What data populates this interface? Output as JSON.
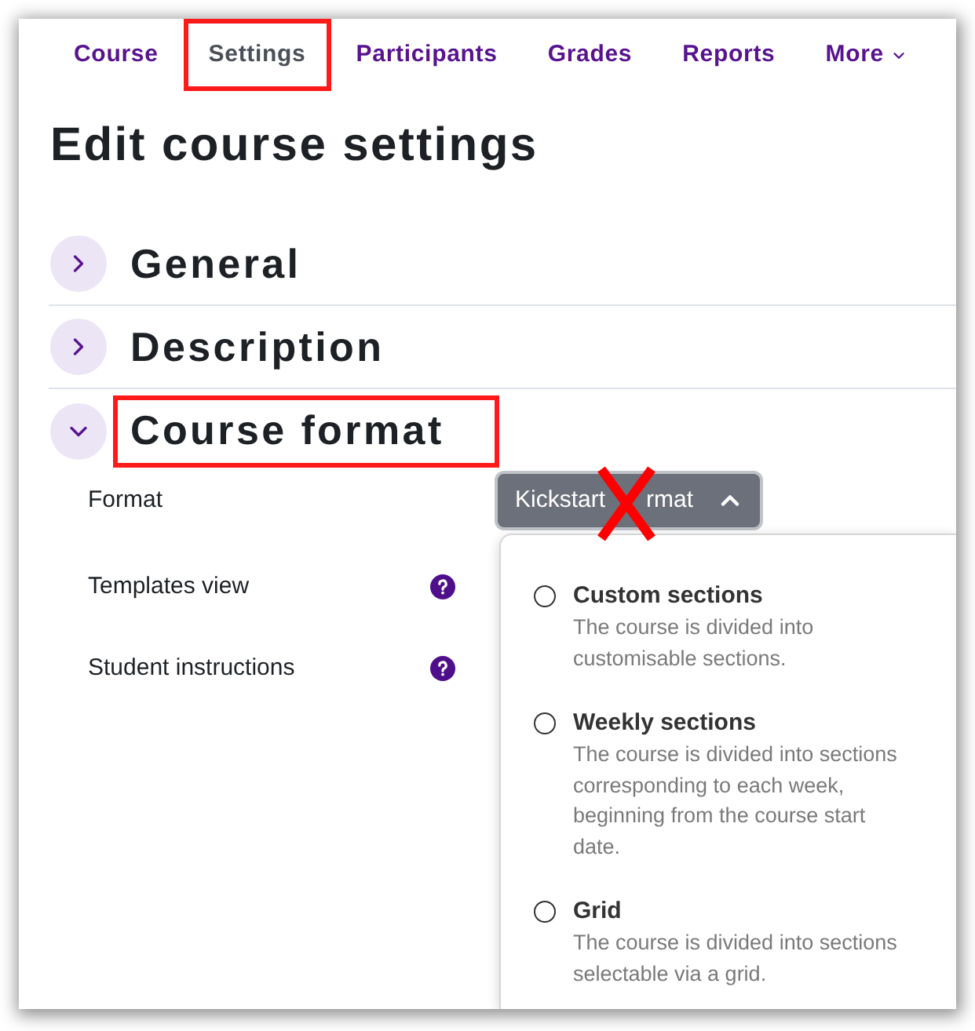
{
  "nav": {
    "items": [
      {
        "label": "Course",
        "selected": false,
        "highlighted": false,
        "kind": "link"
      },
      {
        "label": "Settings",
        "selected": true,
        "highlighted": true,
        "kind": "link"
      },
      {
        "label": "Participants",
        "selected": false,
        "highlighted": false,
        "kind": "link"
      },
      {
        "label": "Grades",
        "selected": false,
        "highlighted": false,
        "kind": "link"
      },
      {
        "label": "Reports",
        "selected": false,
        "highlighted": false,
        "kind": "link"
      },
      {
        "label": "More",
        "selected": false,
        "highlighted": false,
        "kind": "menu"
      }
    ]
  },
  "page_title": "Edit course settings",
  "sections": [
    {
      "title": "General",
      "expanded": false,
      "highlighted": false
    },
    {
      "title": "Description",
      "expanded": false,
      "highlighted": false
    },
    {
      "title": "Course format",
      "expanded": true,
      "highlighted": true
    }
  ],
  "fields": [
    {
      "label": "Format",
      "kind": "select",
      "value_parts": [
        "Kickstart",
        "rmat"
      ],
      "open": true,
      "crossed_out": true
    },
    {
      "label": "Templates view",
      "kind": "help"
    },
    {
      "label": "Student instructions",
      "kind": "help"
    }
  ],
  "format_options": [
    {
      "title": "Custom sections",
      "description": "The course is divided into customisable sections.",
      "selected": false
    },
    {
      "title": "Weekly sections",
      "description": "The course is divided into sections corresponding to each week, beginning from the course start date.",
      "selected": false
    },
    {
      "title": "Grid",
      "description": "The course is divided into sections selectable via a grid.",
      "selected": false
    }
  ]
}
